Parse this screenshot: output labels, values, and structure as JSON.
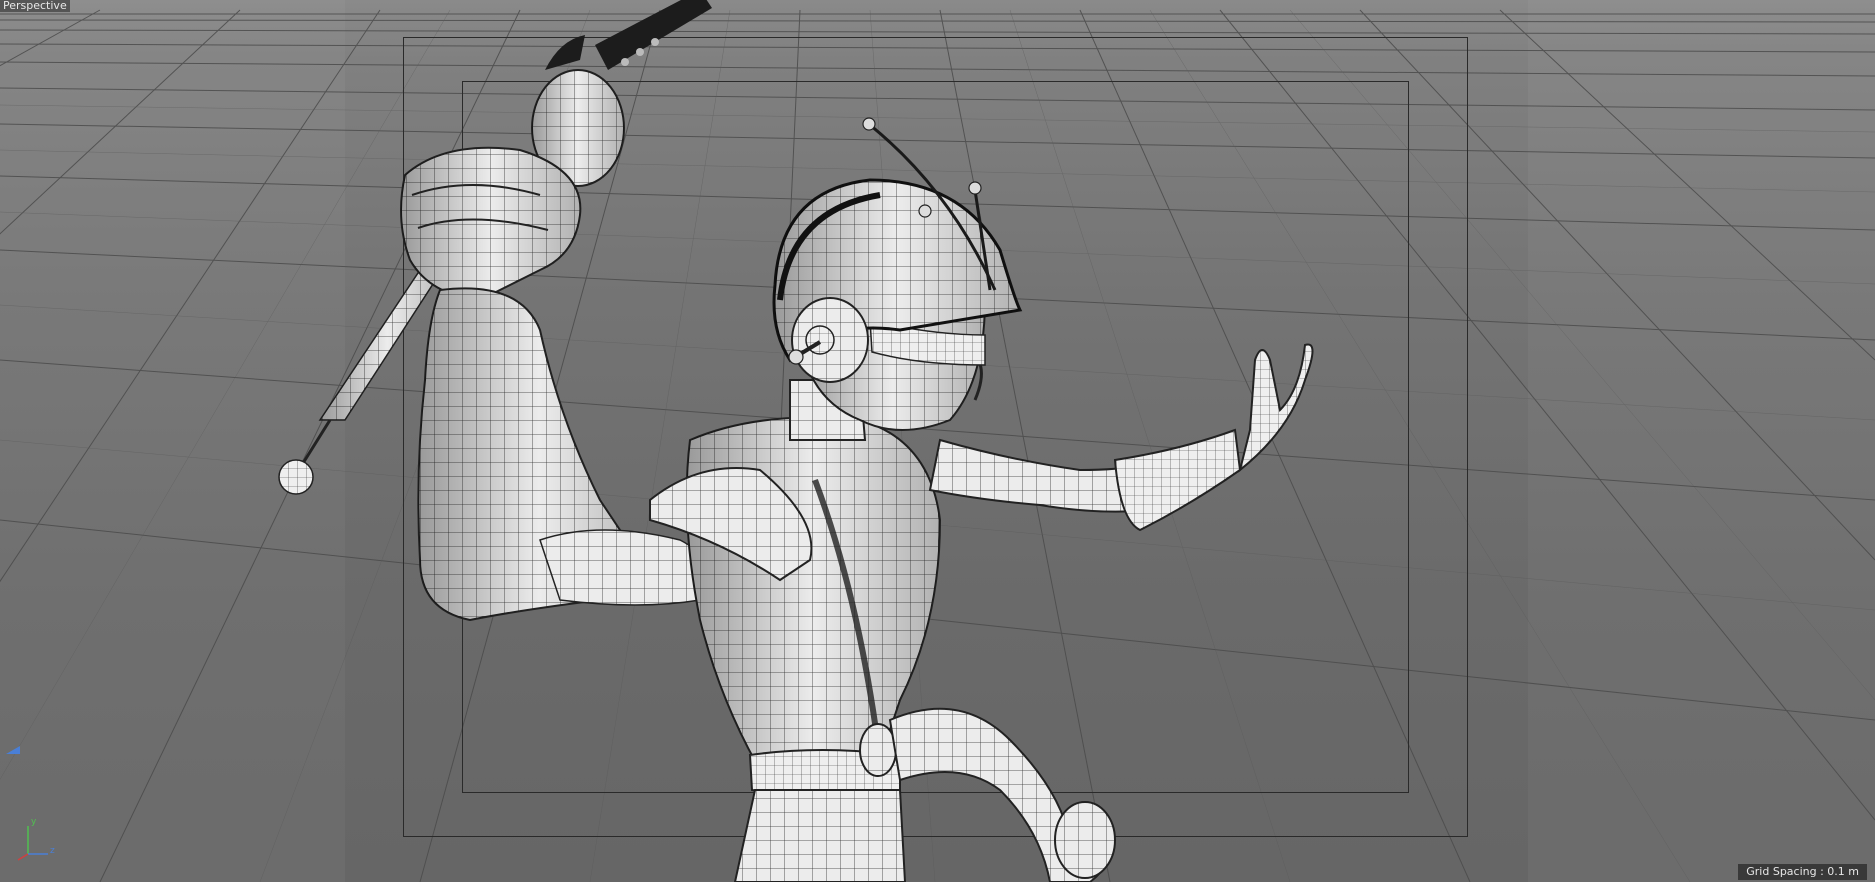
{
  "viewport": {
    "name": "Perspective",
    "grid_spacing_label": "Grid Spacing : 0.1 m"
  },
  "axes": {
    "y": "y",
    "z": "z",
    "x_color": "#d04040",
    "y_color": "#50c050",
    "z_color": "#4a7fd6"
  },
  "colors": {
    "background": "#6b6b6b",
    "grid_line": "#4a4a4a",
    "model_fill": "#e9e9e9",
    "wire": "#2b2b2b"
  }
}
